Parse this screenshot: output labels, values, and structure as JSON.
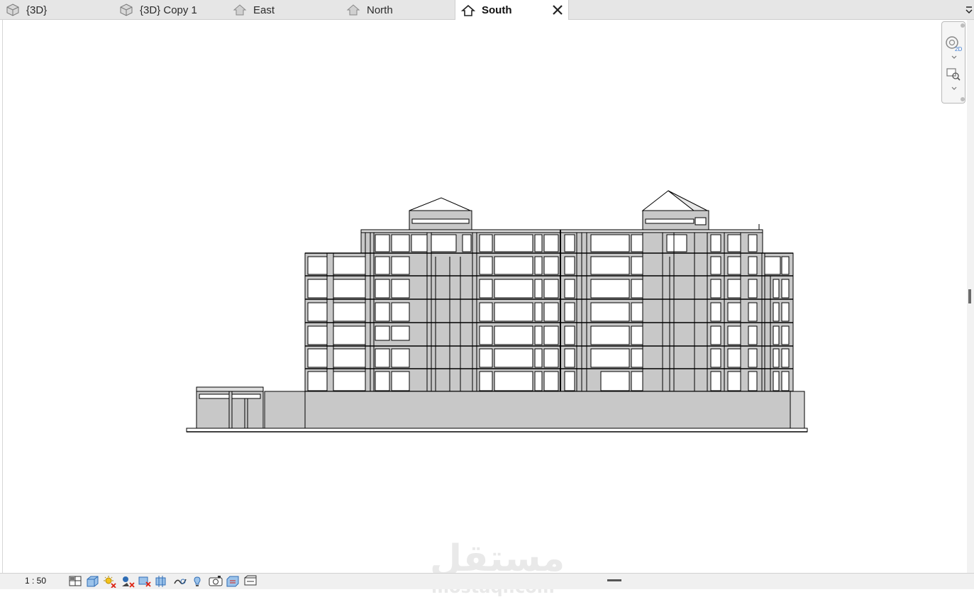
{
  "tabs": [
    {
      "label": "{3D}",
      "icon": "3d-view-icon",
      "active": false
    },
    {
      "label": "{3D} Copy 1",
      "icon": "3d-view-icon",
      "active": false
    },
    {
      "label": "East",
      "icon": "elevation-view-icon",
      "active": false
    },
    {
      "label": "North",
      "icon": "elevation-view-icon",
      "active": false
    },
    {
      "label": "South",
      "icon": "elevation-view-icon",
      "active": true
    }
  ],
  "status": {
    "scale": "1 : 50",
    "icons": [
      "detail-level-icon",
      "visual-style-icon",
      "sun-path-icon",
      "shadows-icon",
      "crop-view-icon",
      "show-crop-region-icon",
      "unlock-3d-view-icon",
      "temporary-hide-icon",
      "reveal-hidden-icon",
      "temporary-view-properties-icon",
      "show-analytical-model-icon",
      "highlight-displacement-icon"
    ]
  },
  "navbar": {
    "items": [
      "steering-wheel-2d-icon",
      "zoom-region-icon"
    ]
  },
  "watermark": {
    "arabic": "مستقل",
    "latin": "mostaql.com"
  },
  "colors": {
    "tab_bg": "#e6e6e6",
    "active_tab_bg": "#ffffff",
    "wall_fill": "#c8c8c8",
    "line": "#000000"
  }
}
